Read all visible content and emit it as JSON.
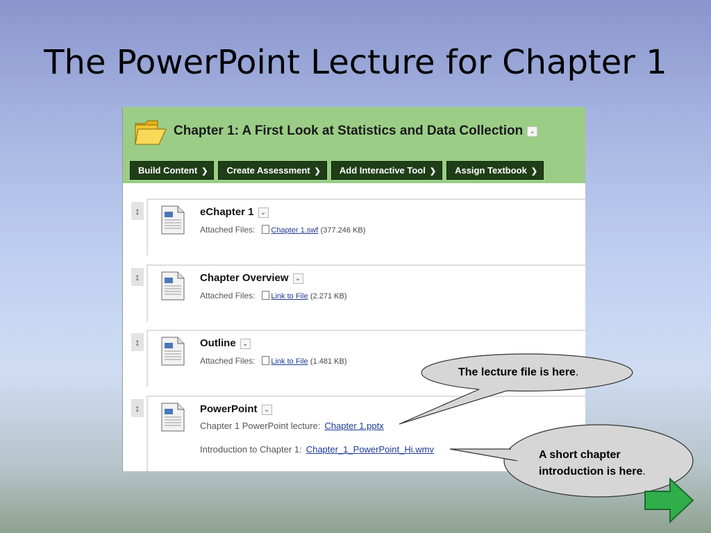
{
  "slide": {
    "title": "The PowerPoint Lecture for Chapter 1"
  },
  "course_page": {
    "chapter_title": "Chapter 1: A First Look at Statistics and Data Collection",
    "toolbar": [
      "Build Content",
      "Create Assessment",
      "Add Interactive Tool",
      "Assign Textbook"
    ],
    "items": [
      {
        "title": "eChapter 1",
        "attach_label": "Attached Files:",
        "file_link": "Chapter 1.swf",
        "file_size": "(377.246 KB)"
      },
      {
        "title": "Chapter Overview",
        "attach_label": "Attached Files:",
        "file_link": "Link to File",
        "file_size": "(2.271 KB)"
      },
      {
        "title": "Outline",
        "attach_label": "Attached Files:",
        "file_link": "Link to File",
        "file_size": "(1.481 KB)"
      },
      {
        "title": "PowerPoint",
        "lecture_label": "Chapter 1 PowerPoint lecture:",
        "lecture_link": "Chapter 1.pptx",
        "intro_label": "Introduction to Chapter 1:",
        "intro_link": "Chapter_1_PowerPoint_Hi.wmv"
      }
    ]
  },
  "callouts": {
    "lecture": {
      "text": "The lecture file is here",
      "period": "."
    },
    "intro": {
      "line1": "A short chapter",
      "line2": "introduction is here",
      "period": "."
    }
  },
  "icons": {
    "next": "next-arrow-icon",
    "handle": "drag-handle-icon",
    "folder": "folder-icon",
    "document": "document-icon",
    "chevron": "chevron-down-icon"
  },
  "colors": {
    "header_green": "#9bcd86",
    "toolbar_green": "#1f3e17",
    "link_blue": "#1c3a94",
    "arrow_green": "#2fae4a"
  }
}
